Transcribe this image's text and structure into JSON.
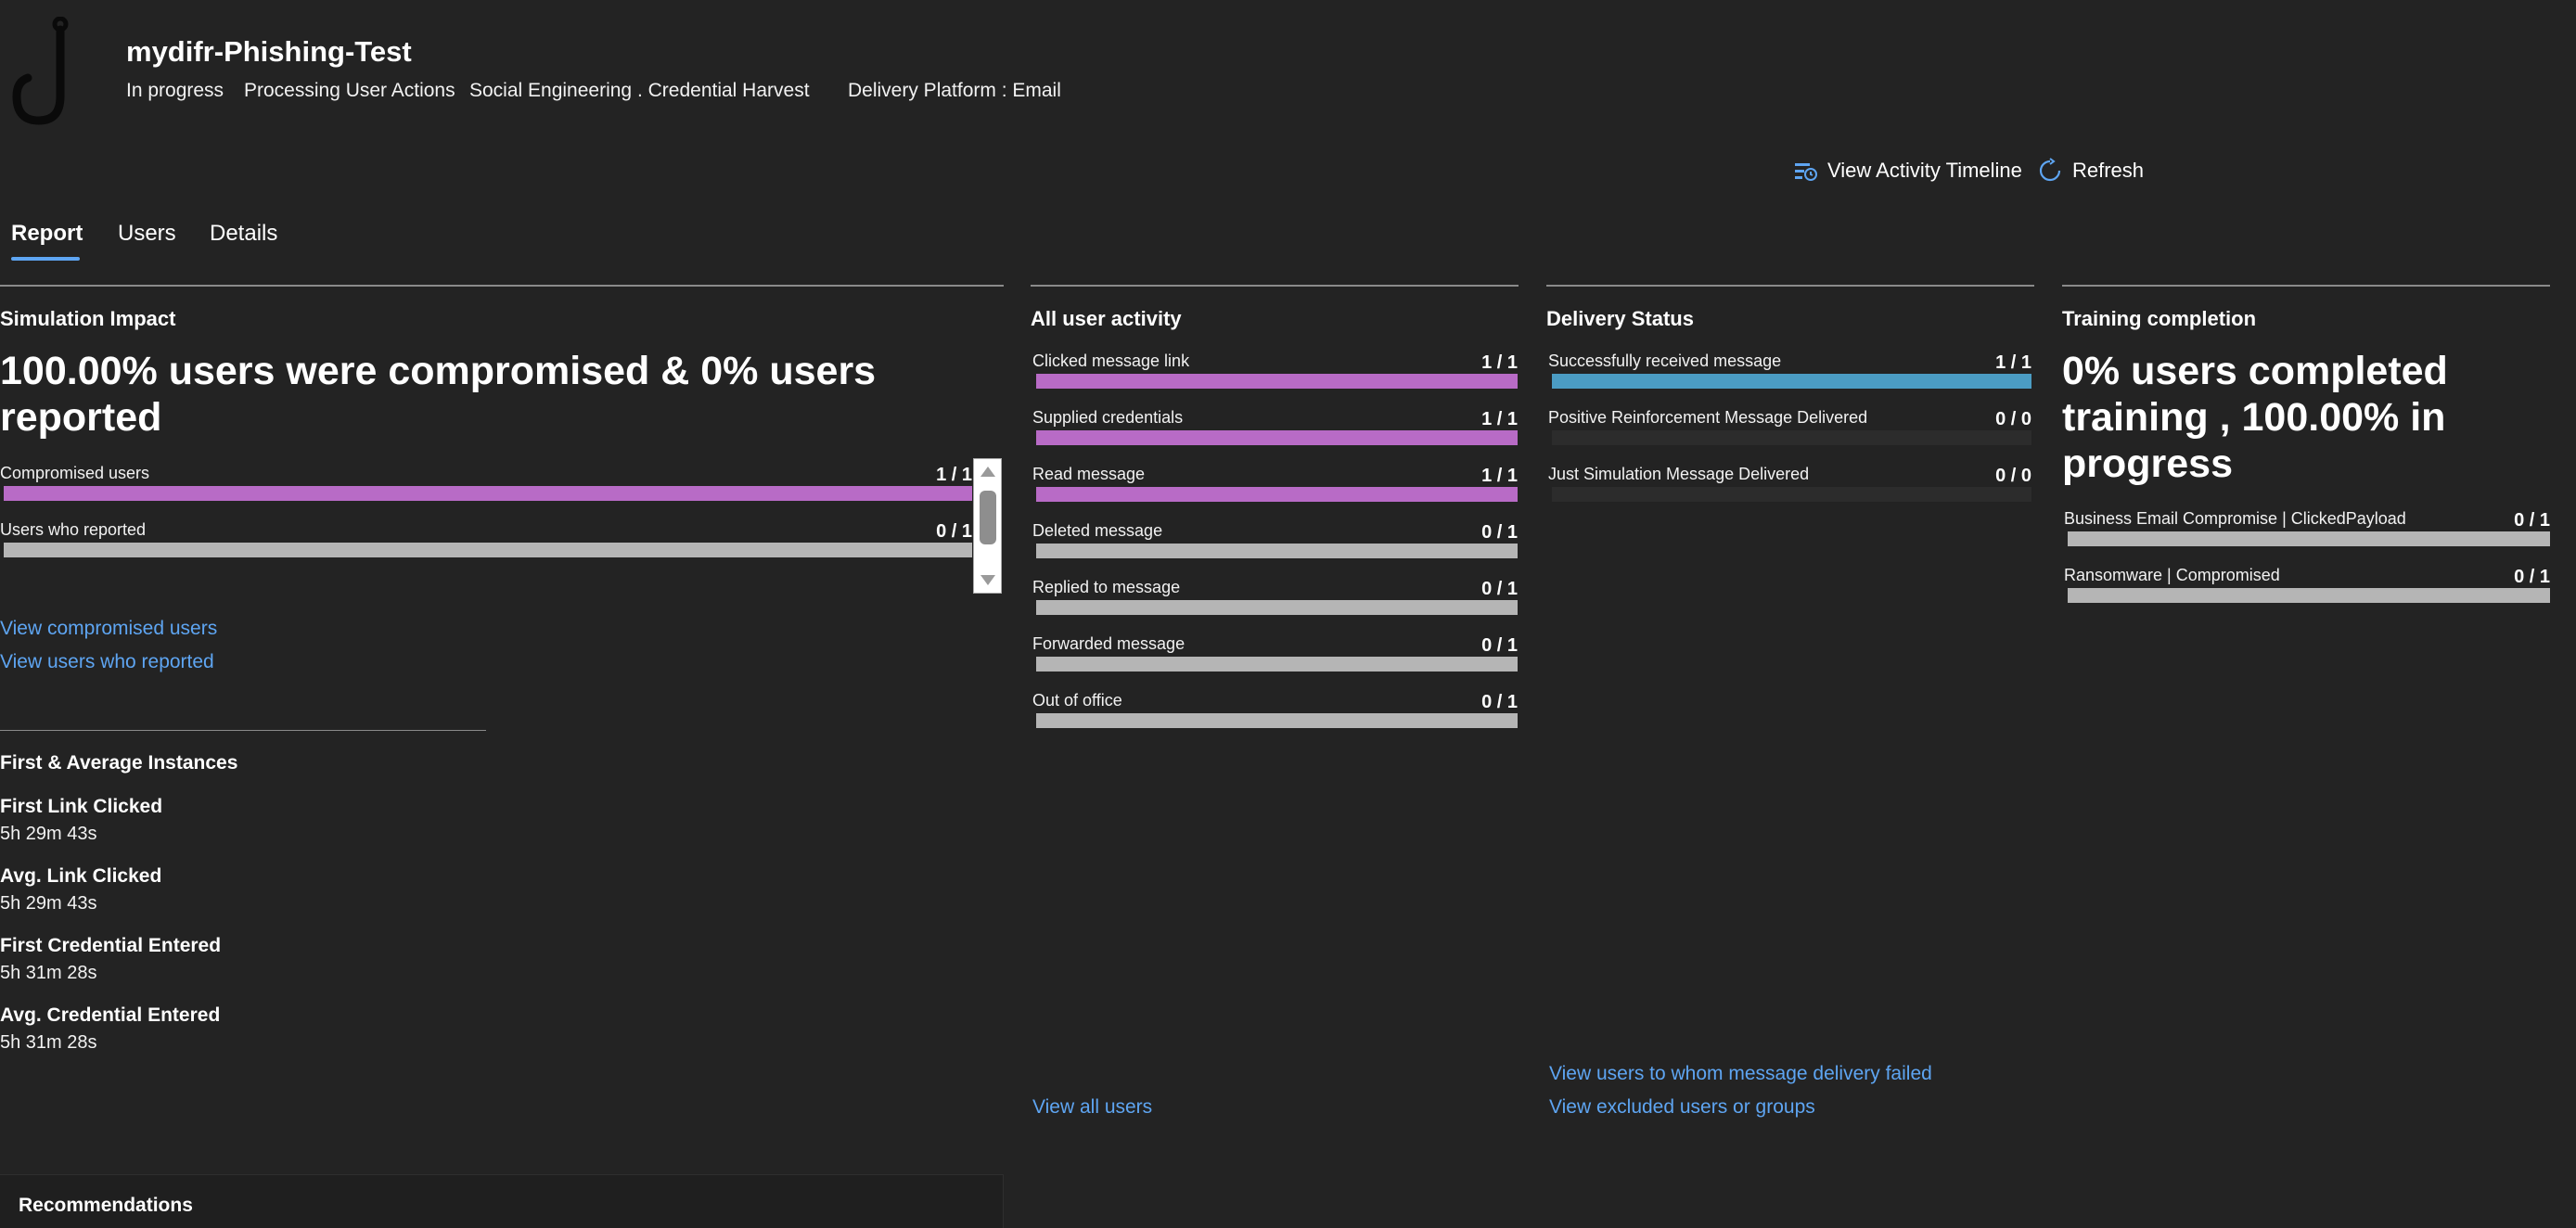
{
  "header": {
    "title": "mydifr-Phishing-Test",
    "status": "In progress",
    "phase": "Processing User Actions",
    "technique": "Social Engineering . Credential Harvest",
    "platform": "Delivery Platform : Email",
    "icon": "fishing-hook-icon"
  },
  "actions": {
    "timeline_label": "View Activity Timeline",
    "refresh_label": "Refresh",
    "timeline_icon": "timeline-icon",
    "refresh_icon": "refresh-icon"
  },
  "tabs": [
    "Report",
    "Users",
    "Details"
  ],
  "active_tab": "Report",
  "colors": {
    "accent": "#5ea5f2",
    "purple_bar": "#b86bc6",
    "blue_bar": "#4b9cc3",
    "gray_bar": "#b5b5b5"
  },
  "impact": {
    "title": "Simulation Impact",
    "headline": "100.00% users were compromised & 0% users reported",
    "bars": [
      {
        "label": "Compromised users",
        "value": "1 / 1",
        "fraction": 1
      },
      {
        "label": "Users who reported",
        "value": "0 / 1",
        "fraction": 0
      }
    ],
    "link_compromised": "View compromised users",
    "link_reported": "View users who reported"
  },
  "instances": {
    "title": "First & Average Instances",
    "items": [
      {
        "label": "First Link Clicked",
        "value": "5h 29m 43s"
      },
      {
        "label": "Avg. Link Clicked",
        "value": "5h 29m 43s"
      },
      {
        "label": "First Credential Entered",
        "value": "5h 31m 28s"
      },
      {
        "label": "Avg. Credential Entered",
        "value": "5h 31m 28s"
      }
    ]
  },
  "activity": {
    "title": "All user activity",
    "bars": [
      {
        "label": "Clicked message link",
        "value": "1 / 1",
        "fraction": 1
      },
      {
        "label": "Supplied credentials",
        "value": "1 / 1",
        "fraction": 1
      },
      {
        "label": "Read message",
        "value": "1 / 1",
        "fraction": 1
      },
      {
        "label": "Deleted message",
        "value": "0 / 1",
        "fraction": 0
      },
      {
        "label": "Replied to message",
        "value": "0 / 1",
        "fraction": 0
      },
      {
        "label": "Forwarded message",
        "value": "0 / 1",
        "fraction": 0
      },
      {
        "label": "Out of office",
        "value": "0 / 1",
        "fraction": 0
      }
    ],
    "link_all": "View all users"
  },
  "delivery": {
    "title": "Delivery Status",
    "bars": [
      {
        "label": "Successfully received message",
        "value": "1 / 1",
        "fraction": 1
      },
      {
        "label": "Positive Reinforcement Message Delivered",
        "value": "0 / 0",
        "fraction": 0
      },
      {
        "label": "Just Simulation Message Delivered",
        "value": "0 / 0",
        "fraction": 0
      }
    ],
    "link_failed": "View users to whom message delivery failed",
    "link_excluded": "View excluded users or groups"
  },
  "training": {
    "title": "Training completion",
    "headline": "0% users completed training , 100.00% in progress",
    "bars": [
      {
        "label": "Business Email Compromise | ClickedPayload",
        "value": "0 / 1",
        "fraction": 0
      },
      {
        "label": "Ransomware | Compromised",
        "value": "0 / 1",
        "fraction": 0
      }
    ]
  },
  "recommendations": {
    "title": "Recommendations"
  }
}
